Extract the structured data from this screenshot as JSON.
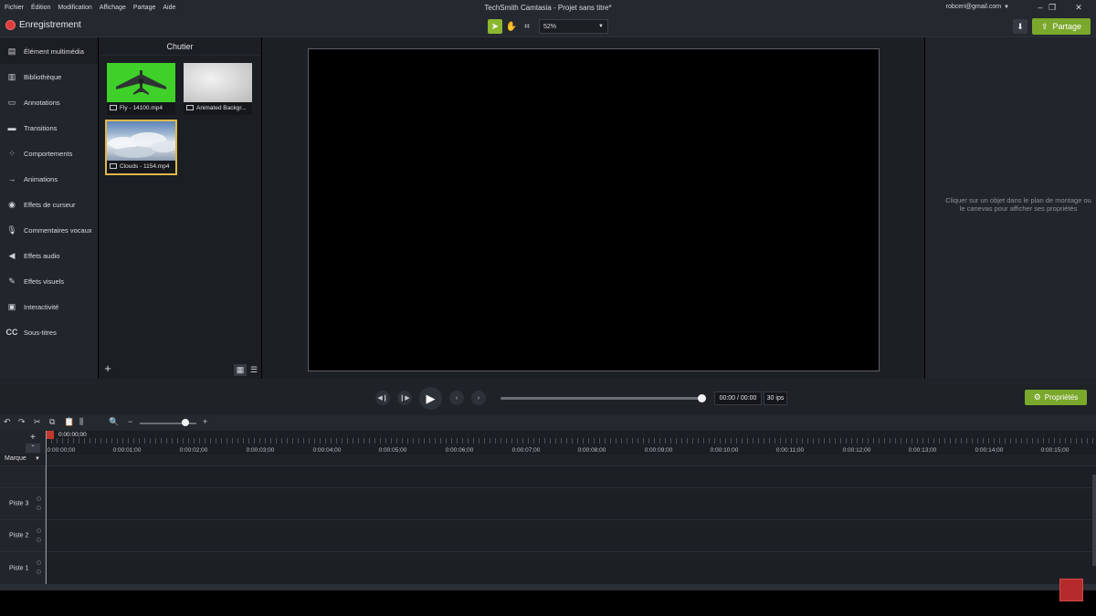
{
  "menubar": {
    "items": [
      "Fichier",
      "Édition",
      "Modification",
      "Affichage",
      "Partage",
      "Aide"
    ],
    "title": "TechSmith Camtasia - Projet sans titre*",
    "account": "robceri@gmail.com"
  },
  "toolbar": {
    "record_label": "Enregistrement",
    "zoom_value": "52%",
    "share_label": "Partage"
  },
  "sidebar": {
    "items": [
      {
        "label": "Élément multimédia",
        "icon": "media-icon"
      },
      {
        "label": "Bibliothèque",
        "icon": "library-icon"
      },
      {
        "label": "Annotations",
        "icon": "annotation-icon"
      },
      {
        "label": "Transitions",
        "icon": "transition-icon"
      },
      {
        "label": "Comportements",
        "icon": "behavior-icon"
      },
      {
        "label": "Animations",
        "icon": "animation-icon"
      },
      {
        "label": "Effets de curseur",
        "icon": "cursor-icon"
      },
      {
        "label": "Commentaires vocaux",
        "icon": "microphone-icon"
      },
      {
        "label": "Effets audio",
        "icon": "speaker-icon"
      },
      {
        "label": "Effets visuels",
        "icon": "wand-icon"
      },
      {
        "label": "Interactivité",
        "icon": "interactive-icon"
      },
      {
        "label": "Sous-titres",
        "icon": "cc-icon"
      }
    ]
  },
  "bin": {
    "title": "Chutier",
    "clips": [
      {
        "name": "Fly - 14100.mp4"
      },
      {
        "name": "Animated Backgr..."
      },
      {
        "name": "Clouds - 1154.mp4"
      }
    ]
  },
  "properties": {
    "hint": "Cliquer sur un objet dans le plan de montage ou le canevas pour afficher ses propriétés",
    "button_label": "Propriétés"
  },
  "transport": {
    "time": "00:00 / 00:00",
    "fps": "30 ips"
  },
  "timeline": {
    "playhead_time": "0:00:00;00",
    "ruler": [
      "0:00:00;00",
      "0:00:01;00",
      "0:00:02;00",
      "0:00:03;00",
      "0:00:04;00",
      "0:00:05;00",
      "0:00:06;00",
      "0:00:07;00",
      "0:00:08;00",
      "0:00:09;00",
      "0:00:10;00",
      "0:00:11;00",
      "0:00:12;00",
      "0:00:13;00",
      "0:00:14;00",
      "0:00:15;00"
    ],
    "marker_label": "Marque",
    "tracks": [
      "Piste 3",
      "Piste 2",
      "Piste 1"
    ]
  },
  "colors": {
    "accent": "#7aa82c",
    "record": "#e03c3c",
    "selection": "#e0b84a"
  }
}
